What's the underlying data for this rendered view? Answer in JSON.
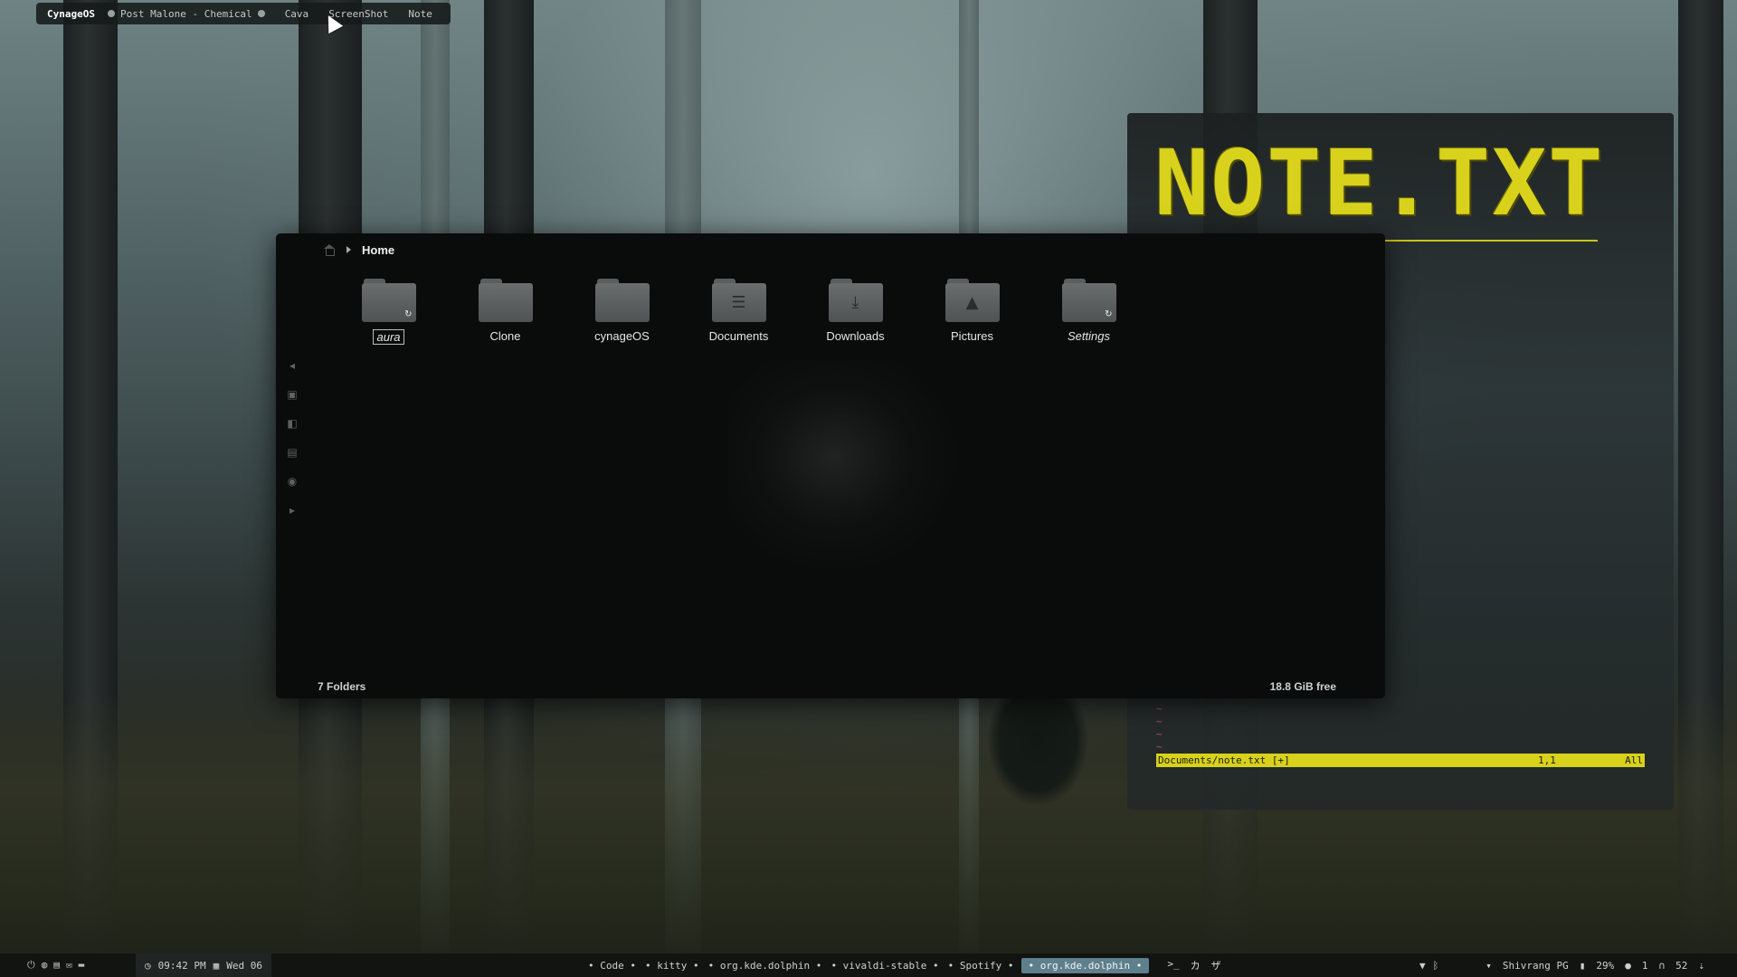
{
  "topbar": {
    "brand": "CynageOS",
    "now_playing": "Post Malone - Chemical",
    "items": [
      "Cava",
      "ScreenShot",
      "Note"
    ]
  },
  "note": {
    "title": "NOTE.TXT",
    "tilde_lines": [
      "~",
      "~",
      "~",
      "~"
    ],
    "status_file": "Documents/note.txt [+]",
    "status_pos": "1,1",
    "status_all": "All",
    "accent": "#d8d21c"
  },
  "dolphin": {
    "breadcrumb": "Home",
    "folders": [
      {
        "label": "aura",
        "glyph": "",
        "badge": "↻"
      },
      {
        "label": "Clone",
        "glyph": "",
        "badge": ""
      },
      {
        "label": "cynageOS",
        "glyph": "",
        "badge": ""
      },
      {
        "label": "Documents",
        "glyph": "☰",
        "badge": ""
      },
      {
        "label": "Downloads",
        "glyph": "⤓",
        "badge": ""
      },
      {
        "label": "Pictures",
        "glyph": "▲",
        "badge": ""
      },
      {
        "label": "Settings",
        "glyph": "",
        "badge": "↻"
      }
    ],
    "status_left": "7 Folders",
    "status_right": "18.8 GiB free",
    "side_tools": [
      "chevron-left-icon",
      "new-folder-icon",
      "split-view-icon",
      "details-icon",
      "preview-eye-icon",
      "chevron-right-icon"
    ]
  },
  "bottombar": {
    "time": "09:42 PM",
    "date": "Wed 06",
    "tasks": [
      "• Code •",
      "• kitty •",
      "• org.kde.dolphin •",
      "• vivaldi-stable •",
      "• Spotify •"
    ],
    "active_task": "• org.kde.dolphin •",
    "extras": [
      ">_",
      "カ",
      "ザ"
    ],
    "network": "Shivrang PG",
    "battery": "29%",
    "bluetooth_count": "1",
    "volume": "52"
  }
}
